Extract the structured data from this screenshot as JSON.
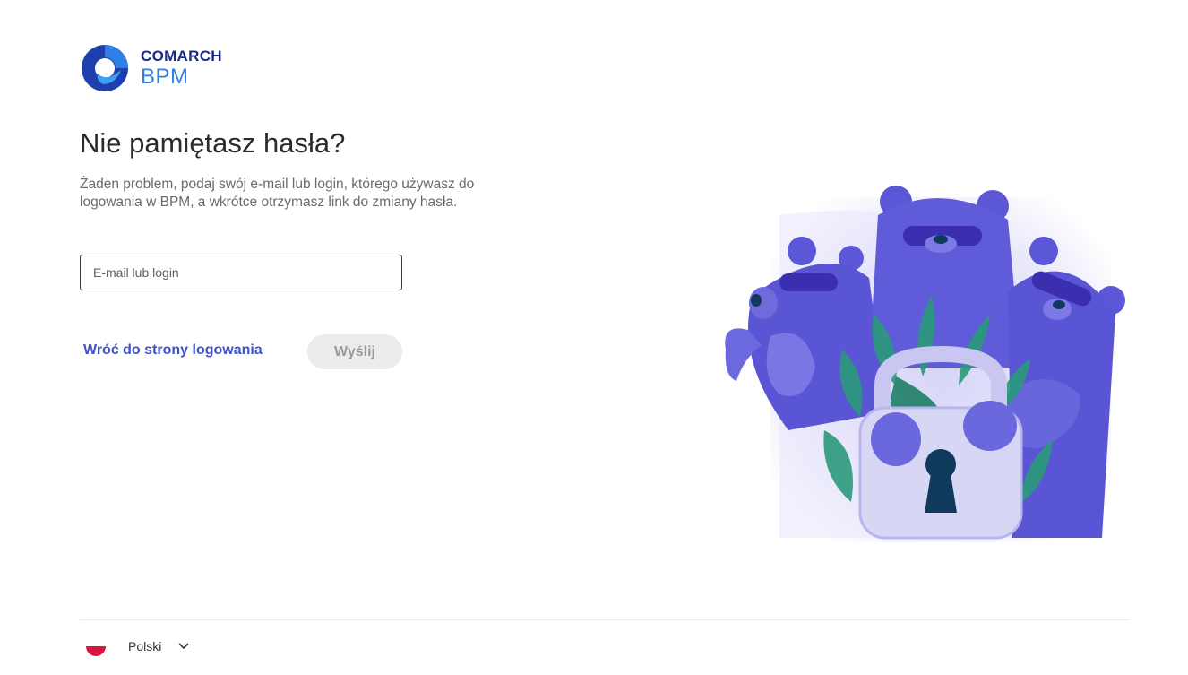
{
  "brand": {
    "company": "COMARCH",
    "product": "BPM",
    "colors": {
      "navy": "#1a2a8c",
      "blue": "#2f7fe6"
    }
  },
  "form": {
    "title": "Nie pamiętasz hasła?",
    "description": "Żaden problem, podaj swój e-mail lub login, którego używasz do logowania w BPM, a wkrótce otrzymasz link do zmiany hasła.",
    "input_placeholder": "E-mail lub login",
    "input_value": "",
    "back_link": "Wróć do strony logowania",
    "submit_label": "Wyślij"
  },
  "footer": {
    "language": "Polski",
    "flag_icon": "poland-flag-icon",
    "chevron_icon": "chevron-down-icon"
  },
  "illustration": {
    "name": "bears-guarding-padlock",
    "colors": {
      "bear": "#5b57d6",
      "leaf": "#2a9a7a",
      "lock": "#d8d6f5"
    }
  }
}
